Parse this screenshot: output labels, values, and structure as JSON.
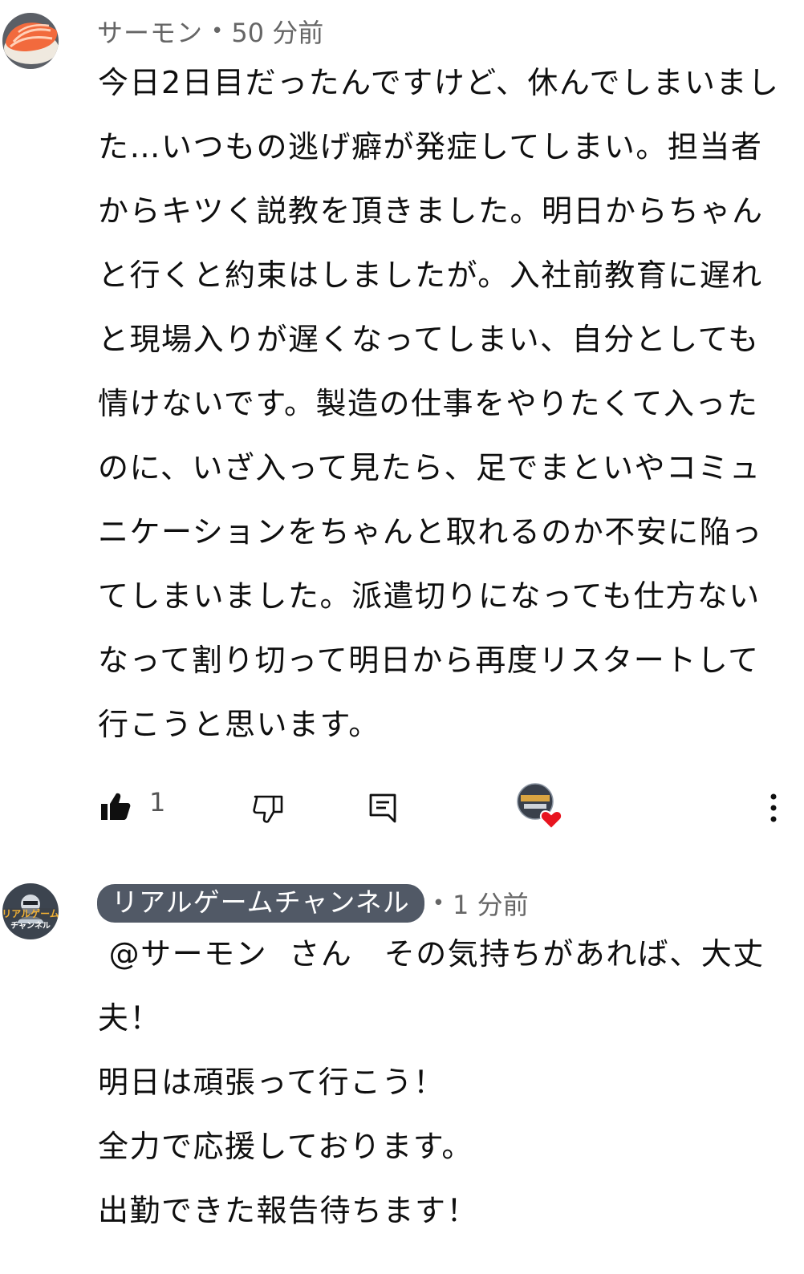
{
  "comments": [
    {
      "author": "サーモン",
      "separator": "•",
      "time": "50 分前",
      "text": "今日2日目だったんですけど、休んでしまいました…いつもの逃げ癖が発症してしまい。担当者からキツく説教を頂きました。明日からちゃんと行くと約束はしましたが。入社前教育に遅れと現場入りが遅くなってしまい、自分としても情けないです。製造の仕事をやりたくて入ったのに、いざ入って見たら、足でまといやコミュニケーションをちゃんと取れるのか不安に陥ってしまいました。派遣切りになっても仕方ないなって割り切って明日から再度リスタートして行こうと思います。",
      "like_count": "1",
      "avatar_icon": "salmon-sushi-icon"
    },
    {
      "author": "リアルゲームチャンネル",
      "separator": "•",
      "time": "1 分前",
      "text": " @サーモン  さん　その気持ちがあれば、大丈夫！\n明日は頑張って行こう！\n全力で応援しております。\n出勤できた報告待ちます！",
      "avatar_icon": "channel-logo-icon",
      "avatar_label": "リアルゲーム",
      "avatar_label_2": "チャンネル"
    }
  ],
  "icons": {
    "like": "thumbs-up-filled-icon",
    "dislike": "thumbs-down-outline-icon",
    "reply": "reply-comment-icon",
    "creator_heart": "creator-heart-icon",
    "more": "more-vertical-icon"
  },
  "colors": {
    "text": "#0f0f0f",
    "meta": "#666666",
    "author_chip": "#515966",
    "heart": "#e8141f"
  }
}
